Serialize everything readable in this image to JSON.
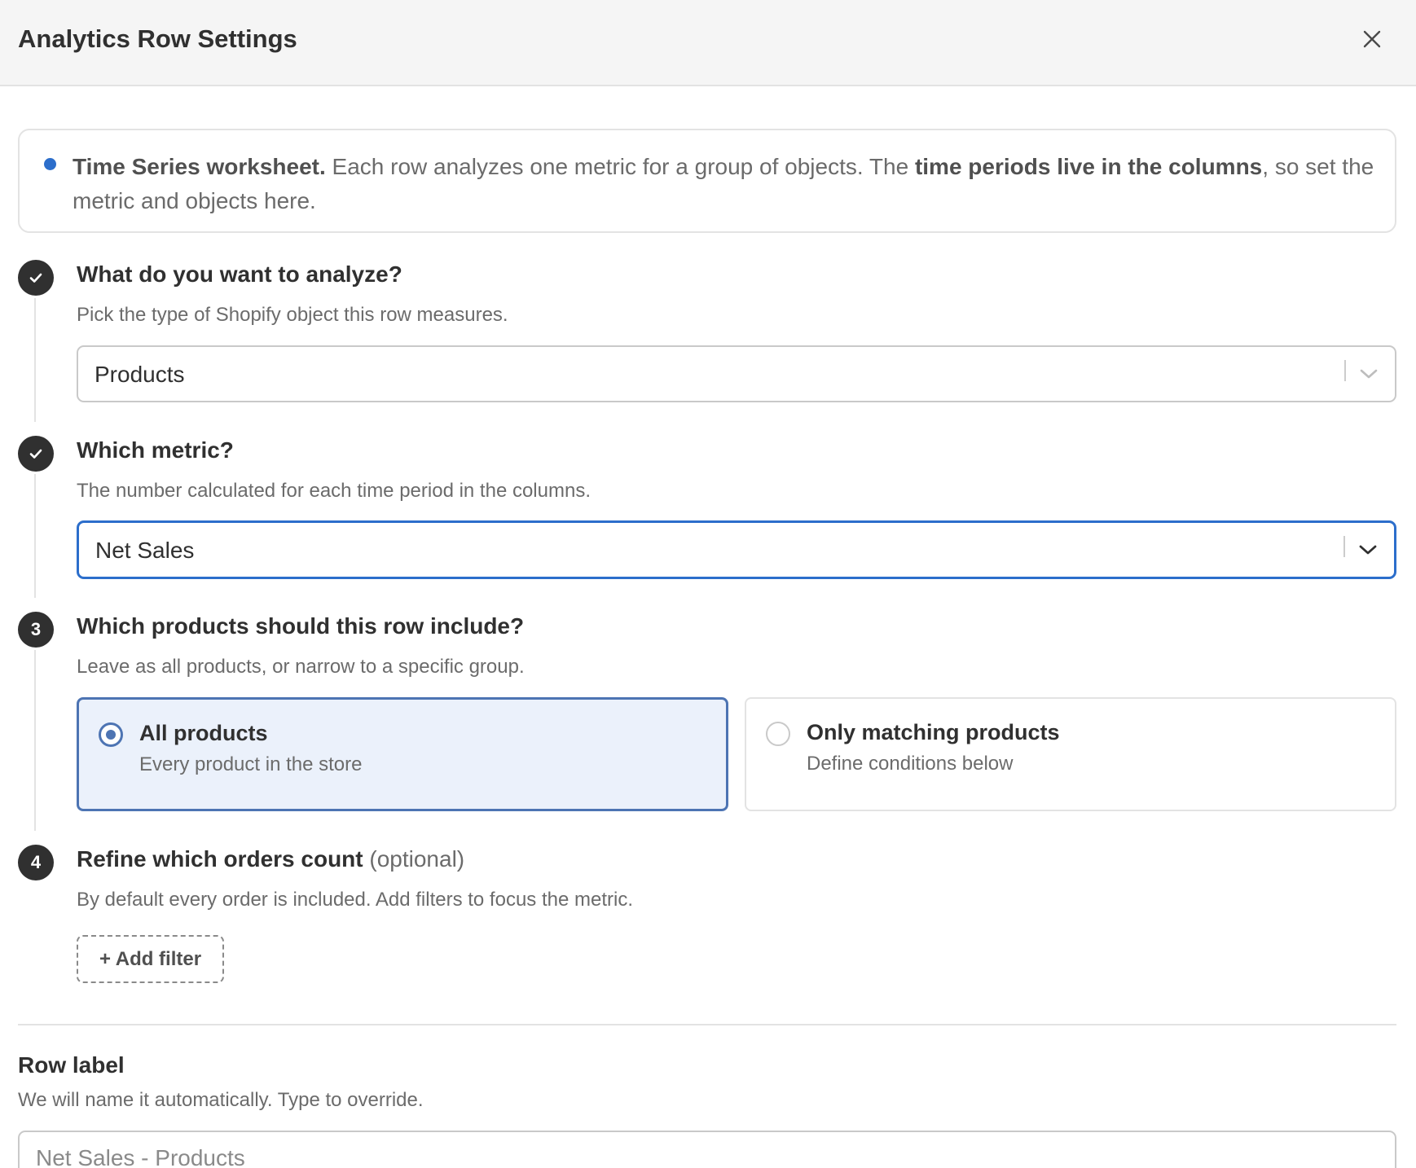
{
  "header": {
    "title": "Analytics Row Settings",
    "close_icon": "close-icon"
  },
  "info": {
    "lead": "Time Series worksheet.",
    "text1": " Each row analyzes one metric for a group of objects. The ",
    "emphasis": "time periods live in the columns",
    "text2": ", so set the metric and objects here.",
    "accent_color": "#2c6ecb"
  },
  "steps": [
    {
      "marker": "check-icon",
      "title": "What do you want to analyze?",
      "description": "Pick the type of Shopify object this row measures.",
      "select_value": "Products"
    },
    {
      "marker": "check-icon",
      "title": "Which metric?",
      "description": "The number calculated for each time period in the columns.",
      "select_value": "Net Sales"
    },
    {
      "number": "3",
      "title": "Which products should this row include?",
      "description": "Leave as all products, or narrow to a specific group.",
      "options": [
        {
          "title": "All products",
          "subtitle": "Every product in the store",
          "selected": true
        },
        {
          "title": "Only matching products",
          "subtitle": "Define conditions below",
          "selected": false
        }
      ]
    },
    {
      "number": "4",
      "title": "Refine which orders count",
      "title_suffix": "(optional)",
      "description": "By default every order is included. Add filters to focus the metric.",
      "button_label": "+ Add filter"
    }
  ],
  "row_label": {
    "title": "Row label",
    "description": "We will name it automatically. Type to override.",
    "placeholder": "Net Sales - Products"
  },
  "colors": {
    "focus_blue": "#2c6ecb",
    "selected_bg": "#ebf1fb",
    "step_circle": "#303030"
  }
}
